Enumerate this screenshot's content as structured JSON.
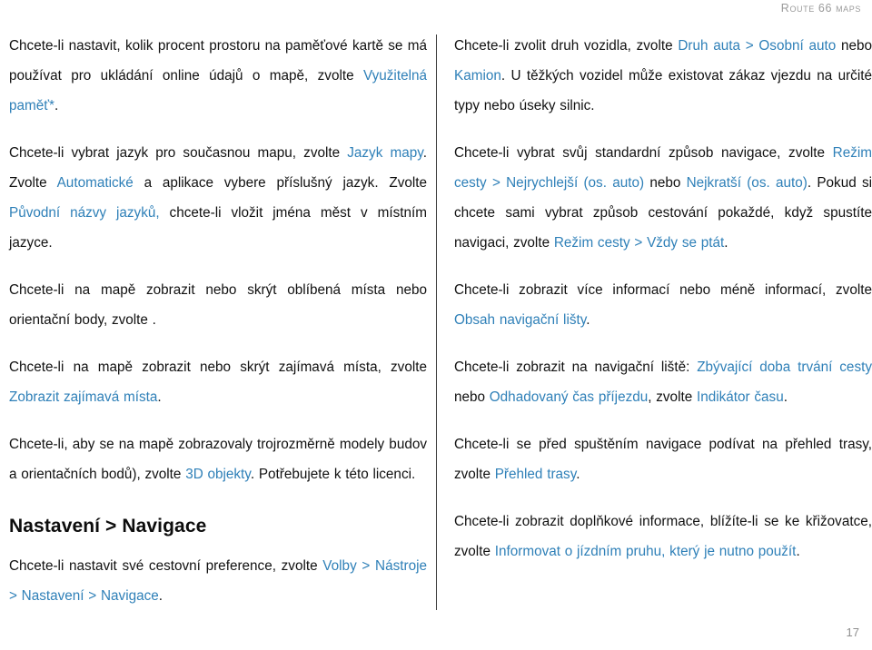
{
  "header": {
    "running_title": "ROUTE 66 MAPS"
  },
  "footer": {
    "page_number": "17"
  },
  "colors": {
    "link": "#2f80b8",
    "body_text": "#111111",
    "header_text": "#9a9a9a",
    "divider": "#3d3d3d"
  },
  "left_column": {
    "paragraphs": [
      {
        "id": "memory-usage",
        "runs": [
          {
            "text": "Chcete-li nastavit, kolik procent prostoru na paměťové kartě se má používat pro ukládání online údajů o mapě, zvolte ",
            "link": false
          },
          {
            "text": "Využitelná paměť*",
            "link": true
          },
          {
            "text": ".",
            "link": false
          }
        ]
      },
      {
        "id": "map-language",
        "runs": [
          {
            "text": "Chcete-li vybrat jazyk pro současnou mapu, zvolte ",
            "link": false
          },
          {
            "text": "Jazyk mapy",
            "link": true
          },
          {
            "text": ". Zvolte ",
            "link": false
          },
          {
            "text": "Automatické",
            "link": true
          },
          {
            "text": " a aplikace vybere příslušný jazyk. Zvolte ",
            "link": false
          },
          {
            "text": "Původní názvy jazyků,",
            "link": true
          },
          {
            "text": " chcete-li vložit jména měst v místním jazyce.",
            "link": false
          }
        ]
      },
      {
        "id": "favourite-places",
        "runs": [
          {
            "text": "Chcete-li na mapě zobrazit nebo skrýt oblíbená místa nebo orientační body, zvolte .",
            "link": false
          }
        ]
      },
      {
        "id": "points-of-interest",
        "runs": [
          {
            "text": "Chcete-li na mapě zobrazit nebo skrýt zajímavá místa, zvolte ",
            "link": false
          },
          {
            "text": "Zobrazit zajímavá místa",
            "link": true
          },
          {
            "text": ".",
            "link": false
          }
        ]
      },
      {
        "id": "three-d-objects",
        "runs": [
          {
            "text": "Chcete-li, aby se na mapě zobrazovaly trojrozměrně modely budov a orientačních bodů), zvolte ",
            "link": false
          },
          {
            "text": "3D objekty",
            "link": true
          },
          {
            "text": ". Potřebujete k této licenci.",
            "link": false
          }
        ]
      }
    ],
    "heading": "Nastavení > Navigace",
    "heading_paragraph": {
      "id": "travel-preferences",
      "runs": [
        {
          "text": "Chcete-li nastavit své cestovní preference, zvolte ",
          "link": false
        },
        {
          "text": "Volby > Nástroje > Nastavení > Navigace",
          "link": true
        },
        {
          "text": ".",
          "link": false
        }
      ]
    }
  },
  "right_column": {
    "paragraphs": [
      {
        "id": "vehicle-type",
        "runs": [
          {
            "text": "Chcete-li zvolit druh vozidla, zvolte ",
            "link": false
          },
          {
            "text": "Druh auta > Osobní auto",
            "link": true
          },
          {
            "text": " nebo ",
            "link": false
          },
          {
            "text": "Kamion",
            "link": true
          },
          {
            "text": ". U těžkých vozidel může existovat zákaz vjezdu na určité typy nebo úseky silnic.",
            "link": false
          }
        ]
      },
      {
        "id": "route-mode",
        "runs": [
          {
            "text": "Chcete-li vybrat svůj standardní způsob navigace, zvolte ",
            "link": false
          },
          {
            "text": "Režim cesty > Nejrychlejší (os. auto)",
            "link": true
          },
          {
            "text": " nebo ",
            "link": false
          },
          {
            "text": "Nejkratší (os. auto)",
            "link": true
          },
          {
            "text": ". Pokud si chcete sami vybrat způsob cestování pokaždé, když spustíte navigaci, zvolte ",
            "link": false
          },
          {
            "text": "Režim cesty > Vždy se ptát",
            "link": true
          },
          {
            "text": ".",
            "link": false
          }
        ]
      },
      {
        "id": "navigation-bar-content",
        "runs": [
          {
            "text": "Chcete-li zobrazit více informací nebo méně informací, zvolte ",
            "link": false
          },
          {
            "text": "Obsah navigační lišty",
            "link": true
          },
          {
            "text": ".",
            "link": false
          }
        ]
      },
      {
        "id": "time-indicator",
        "runs": [
          {
            "text": "Chcete-li zobrazit na navigační liště: ",
            "link": false
          },
          {
            "text": "Zbývající doba trvání cesty",
            "link": true
          },
          {
            "text": " nebo ",
            "link": false
          },
          {
            "text": "Odhadovaný čas příjezdu",
            "link": true
          },
          {
            "text": ", zvolte ",
            "link": false
          },
          {
            "text": "Indikátor času",
            "link": true
          },
          {
            "text": ".",
            "link": false
          }
        ]
      },
      {
        "id": "route-overview",
        "runs": [
          {
            "text": "Chcete-li se před spuštěním navigace podívat na přehled trasy, zvolte ",
            "link": false
          },
          {
            "text": "Přehled trasy",
            "link": true
          },
          {
            "text": ".",
            "link": false
          }
        ]
      },
      {
        "id": "lane-info",
        "runs": [
          {
            "text": "Chcete-li zobrazit doplňkové informace, blížíte-li se ke křižovatce, zvolte ",
            "link": false
          },
          {
            "text": "Informovat o jízdním pruhu, který je nutno použít",
            "link": true
          },
          {
            "text": ".",
            "link": false
          }
        ]
      }
    ]
  }
}
